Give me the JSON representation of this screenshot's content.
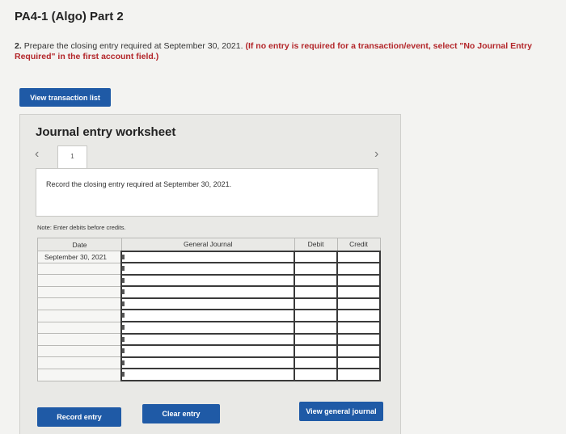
{
  "page": {
    "title": "PA4-1 (Algo) Part 2",
    "instruction_number": "2.",
    "instruction_text": "Prepare the closing entry required at September 30, 2021.",
    "instruction_note": "(If no entry is required for a transaction/event, select \"No Journal Entry Required\" in the first account field.)"
  },
  "buttons": {
    "view_transaction_list": "View transaction list",
    "record_entry": "Record entry",
    "clear_entry": "Clear entry",
    "view_general_journal": "View general journal"
  },
  "worksheet": {
    "title": "Journal entry worksheet",
    "tab_label": "1",
    "record_text": "Record the closing entry required at September 30, 2021.",
    "note": "Note: Enter debits before credits.",
    "prev_icon": "chevron-left-icon",
    "next_icon": "chevron-right-icon"
  },
  "table": {
    "headers": {
      "date": "Date",
      "general_journal": "General Journal",
      "debit": "Debit",
      "credit": "Credit"
    },
    "first_date": "September 30, 2021"
  },
  "colors": {
    "button": "#1f5aa6",
    "note_red": "#b3262a"
  }
}
